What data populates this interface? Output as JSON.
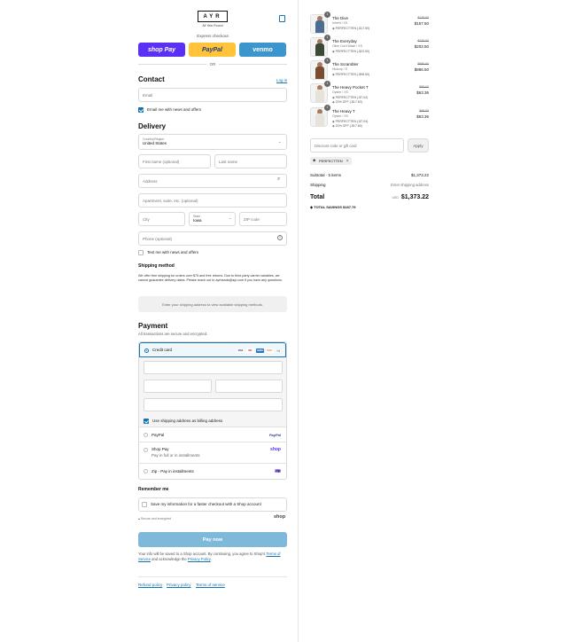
{
  "header": {
    "brand": "AYR",
    "tagline": "All Year Round"
  },
  "express": {
    "label": "Express checkout",
    "shop_pay": "shop Pay",
    "paypal": "PayPal",
    "venmo": "venmo",
    "or": "OR",
    "colors": {
      "shop_pay": "#5a31f4",
      "paypal": "#ffc439",
      "venmo": "#3d95ce"
    }
  },
  "contact": {
    "title": "Contact",
    "login": "Log in",
    "email_placeholder": "Email",
    "news_label": "Email me with news and offers"
  },
  "delivery": {
    "title": "Delivery",
    "country_label": "Country/Region",
    "country_value": "United States",
    "first_name": "First name (optional)",
    "last_name": "Last name",
    "address": "Address",
    "apartment": "Apartment, suite, etc. (optional)",
    "city": "City",
    "state_label": "State",
    "state_value": "Iowa",
    "zip": "ZIP code",
    "phone": "Phone (optional)",
    "text_news": "Text me with news and offers"
  },
  "shipping": {
    "title": "Shipping method",
    "note": "We offer free shipping for orders over $75 and free returns. Due to third party carrier variables, we cannot guarantee delivery dates. Please reach out to ayrheads@ayr.com if you have any questions.",
    "placeholder": "Enter your shipping address to view available shipping methods."
  },
  "payment": {
    "title": "Payment",
    "subtitle": "All transactions are secure and encrypted.",
    "credit_card": "Credit card",
    "billing_same": "Use shipping address as billing address",
    "paypal": "PayPal",
    "shop_pay": "Shop Pay",
    "shop_pay_sub": "Pay in full or in installments",
    "zip": "Zip - Pay in installments",
    "more_cards": "+4",
    "card_logos": [
      "VISA",
      "MC",
      "AMEX",
      "DISC"
    ],
    "paypal_logo": "PayPal",
    "shop_logo": "shop",
    "zip_logo": "zip"
  },
  "remember": {
    "title": "Remember me",
    "save_label": "Save my information for a faster checkout with a Shop account",
    "secure": "Secure and encrypted",
    "shop_logo": "shop"
  },
  "pay_now": "Pay now",
  "consent": {
    "text_1": "Your info will be saved to a Shop account. By continuing, you agree to Shop's",
    "terms": "Terms of Service",
    "text_2": "and acknowledge the",
    "privacy": "Privacy Policy",
    "end": "."
  },
  "footer": {
    "refund": "Refund policy",
    "privacy": "Privacy policy",
    "terms": "Terms of service"
  },
  "cart": {
    "items": [
      {
        "qty": "1",
        "name": "The Dive",
        "variant": "Inherit / XS",
        "discount": "PERFECTTEN (-$17.50)",
        "extra": "",
        "original": "$175.00",
        "price": "$157.50",
        "color": "#4a6f93"
      },
      {
        "qty": "1",
        "name": "The Everyday",
        "variant": "Olive Cord Wash / XS",
        "discount": "PERFECTTEN (-$22.50)",
        "extra": "",
        "original": "$225.00",
        "price": "$202.50",
        "color": "#3a4a36"
      },
      {
        "qty": "1",
        "name": "The Scrambler",
        "variant": "Hickory / S",
        "discount": "PERFECTTEN (-$98.50)",
        "extra": "",
        "original": "$985.00",
        "price": "$886.50",
        "color": "#7a4b2e"
      },
      {
        "qty": "1",
        "name": "The Heavy Pocket T",
        "variant": "Oyster / XS",
        "discount": "PERFECTTEN (-$7.04)",
        "extra": "20% OFF (-$17.60)",
        "original": "$88.00",
        "price": "$63.36",
        "color": "#e7e3da"
      },
      {
        "qty": "1",
        "name": "The Heavy T",
        "variant": "Oyster / XS",
        "discount": "PERFECTTEN (-$7.04)",
        "extra": "20% OFF (-$17.60)",
        "original": "$88.00",
        "price": "$63.36",
        "color": "#e7e3da"
      }
    ],
    "discount_placeholder": "Discount code or gift card",
    "apply": "Apply",
    "applied_code": "PERFECTTEN",
    "subtotal_label": "Subtotal · 5 items",
    "subtotal_value": "$1,373.22",
    "shipping_label": "Shipping",
    "shipping_value": "Enter shipping address",
    "total_label": "Total",
    "currency": "USD",
    "total_value": "$1,373.22",
    "savings_label": "TOTAL SAVINGS",
    "savings_value": "$187.79"
  }
}
